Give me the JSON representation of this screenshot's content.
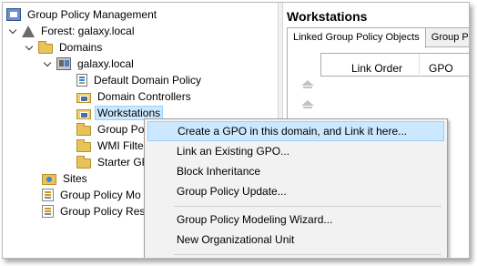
{
  "tree": {
    "root": "Group Policy Management",
    "forest": "Forest: galaxy.local",
    "domains": "Domains",
    "domain": "galaxy.local",
    "default_policy": "Default Domain Policy",
    "domain_controllers": "Domain Controllers",
    "workstations": "Workstations",
    "group_policy_objects_trunc": "Group Po",
    "wmi_filters_trunc": "WMI Filte",
    "starter_gpos_trunc": "Starter GP",
    "sites": "Sites",
    "modeling_trunc": "Group Policy Mo",
    "results_trunc": "Group Policy Res"
  },
  "right": {
    "title": "Workstations",
    "tabs": [
      "Linked Group Policy Objects",
      "Group Po"
    ],
    "columns": [
      "Link Order",
      "GPO"
    ]
  },
  "context_menu": {
    "items": [
      "Create a GPO in this domain, and Link it here...",
      "Link an Existing GPO...",
      "Block Inheritance",
      "Group Policy Update...",
      "Group Policy Modeling Wizard...",
      "New Organizational Unit"
    ]
  }
}
